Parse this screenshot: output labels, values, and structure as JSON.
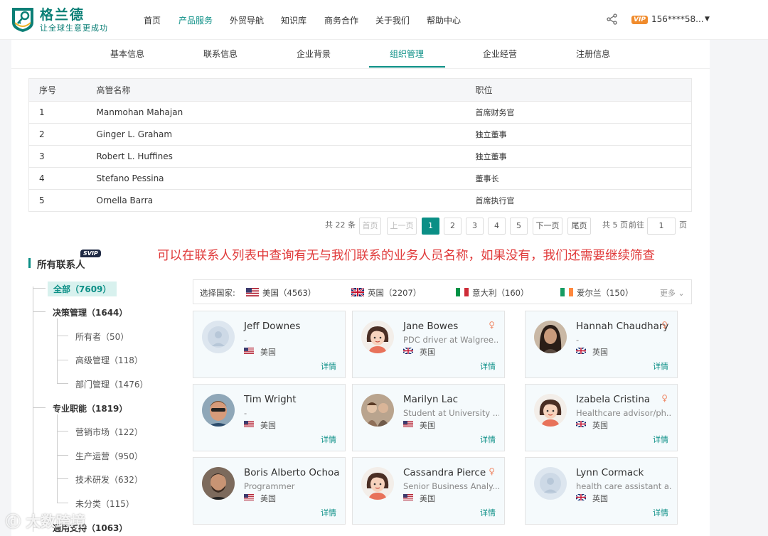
{
  "header": {
    "brand": "格兰德",
    "slogan": "让全球生意更成功",
    "nav": [
      "首页",
      "产品服务",
      "外贸导航",
      "知识库",
      "商务合作",
      "关于我们",
      "帮助中心"
    ],
    "active_nav": "产品服务",
    "vip_badge": "VIP",
    "user_phone": "156****58..."
  },
  "subtabs": [
    "基本信息",
    "联系信息",
    "企业背景",
    "组织管理",
    "企业经营",
    "注册信息"
  ],
  "active_subtab": "组织管理",
  "exec_table": {
    "headers": [
      "序号",
      "高管名称",
      "职位"
    ],
    "rows": [
      [
        "1",
        "Manmohan Mahajan",
        "首席财务官"
      ],
      [
        "2",
        "Ginger L. Graham",
        "独立董事"
      ],
      [
        "3",
        "Robert L. Huffines",
        "独立董事"
      ],
      [
        "4",
        "Stefano Pessina",
        "董事长"
      ],
      [
        "5",
        "Ornella Barra",
        "首席执行官"
      ]
    ]
  },
  "pagination": {
    "total": "共 22 条",
    "first": "首页",
    "prev": "上一页",
    "pages": [
      "1",
      "2",
      "3",
      "4",
      "5"
    ],
    "current": "1",
    "next": "下一页",
    "last": "尾页",
    "page_count": "共 5 页",
    "goto": "前往",
    "goto_value": "1",
    "page_unit": "页"
  },
  "annotation": "可以在联系人列表中查询有无与我们联系的业务人员名称，如果没有，我们还需要继续筛查",
  "contacts_section": {
    "title": "所有联系人",
    "badge": "SVIP",
    "tree": {
      "all": "全部（7609）",
      "groups": [
        {
          "label": "决策管理（1644）",
          "items": [
            "所有者（50）",
            "高级管理（118）",
            "部门管理（1476）"
          ]
        },
        {
          "label": "专业职能（1819）",
          "items": [
            "营销市场（122）",
            "生产运营（950）",
            "技术研发（632）",
            "未分类（115）"
          ]
        },
        {
          "label": "通用支持（1063）",
          "items": []
        }
      ]
    },
    "country_filter": {
      "label": "选择国家:",
      "options": [
        {
          "name": "美国（4563）",
          "flag": "us"
        },
        {
          "name": "英国（2207）",
          "flag": "gb"
        },
        {
          "name": "意大利（160）",
          "flag": "it"
        },
        {
          "name": "爱尔兰（150）",
          "flag": "ie"
        }
      ],
      "more": "更多"
    },
    "detail_label": "详情",
    "cards": [
      {
        "name": "Jeff Downes",
        "title": "-",
        "country": "美国",
        "flag": "us",
        "avatar": "default",
        "female": false
      },
      {
        "name": "Jane Bowes",
        "title": "PDC driver at Walgree...",
        "country": "英国",
        "flag": "gb",
        "avatar": "girl",
        "female": true
      },
      {
        "name": "Hannah Chaudhary",
        "title": "-",
        "country": "英国",
        "flag": "gb",
        "avatar": "photo-hannah",
        "female": true
      },
      {
        "name": "Tim Wright",
        "title": "-",
        "country": "美国",
        "flag": "us",
        "avatar": "photo-tim",
        "female": false
      },
      {
        "name": "Marilyn Lac",
        "title": "Student at University ...",
        "country": "美国",
        "flag": "us",
        "avatar": "photo-marilyn",
        "female": false
      },
      {
        "name": "Izabela Cristina",
        "title": "Healthcare advisor/ph...",
        "country": "英国",
        "flag": "gb",
        "avatar": "girl",
        "female": true
      },
      {
        "name": "Boris Alberto Ochoa",
        "title": "Programmer",
        "country": "美国",
        "flag": "us",
        "avatar": "photo-boris",
        "female": false
      },
      {
        "name": "Cassandra Pierce",
        "title": "Senior Business Analy...",
        "country": "美国",
        "flag": "us",
        "avatar": "girl",
        "female": true
      },
      {
        "name": "Lynn Cormack",
        "title": "health care assistant a...",
        "country": "英国",
        "flag": "gb",
        "avatar": "default",
        "female": false
      }
    ]
  },
  "watermark": "大数跨境",
  "colors": {
    "brand": "#0b8f86",
    "annotation": "#e03a3a",
    "vip": "#f08b2c"
  }
}
